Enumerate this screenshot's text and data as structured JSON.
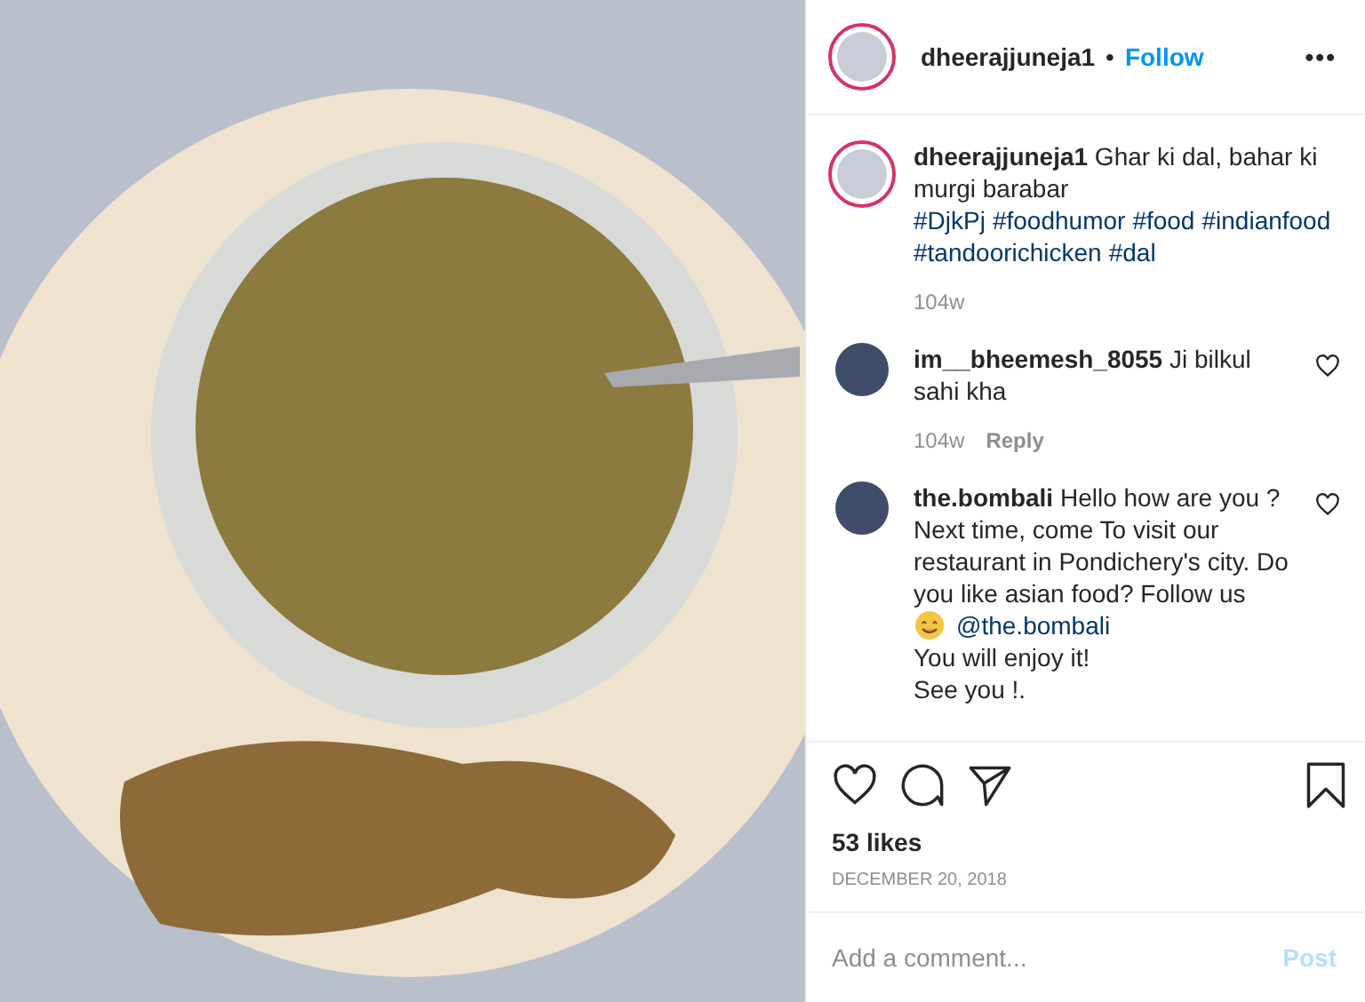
{
  "post": {
    "username": "dheerajjuneja1",
    "separator": "•",
    "follow": "Follow",
    "more": "•••"
  },
  "caption": {
    "username": "dheerajjuneja1",
    "text": "Ghar ki dal, bahar ki murgi barabar",
    "hashtags": [
      "#DjkPj",
      "#foodhumor",
      "#food",
      "#indianfood",
      "#tandoorichicken",
      "#dal"
    ],
    "time": "104w"
  },
  "comments": [
    {
      "username": "im__bheemesh_8055",
      "text": "Ji bilkul sahi kha",
      "time": "104w",
      "reply": "Reply",
      "liked": false
    },
    {
      "username": "the.bombali",
      "text": "Hello how are you ? Next time, come To visit our restaurant in Pondichery's city. Do you like asian food? Follow us",
      "mention": "@the.bombali",
      "lines": [
        "You will enjoy it!",
        "See you !."
      ],
      "liked": false
    }
  ],
  "likes": "53 likes",
  "date": "DECEMBER 20, 2018",
  "add_comment": {
    "placeholder": "Add a comment...",
    "post": "Post"
  }
}
